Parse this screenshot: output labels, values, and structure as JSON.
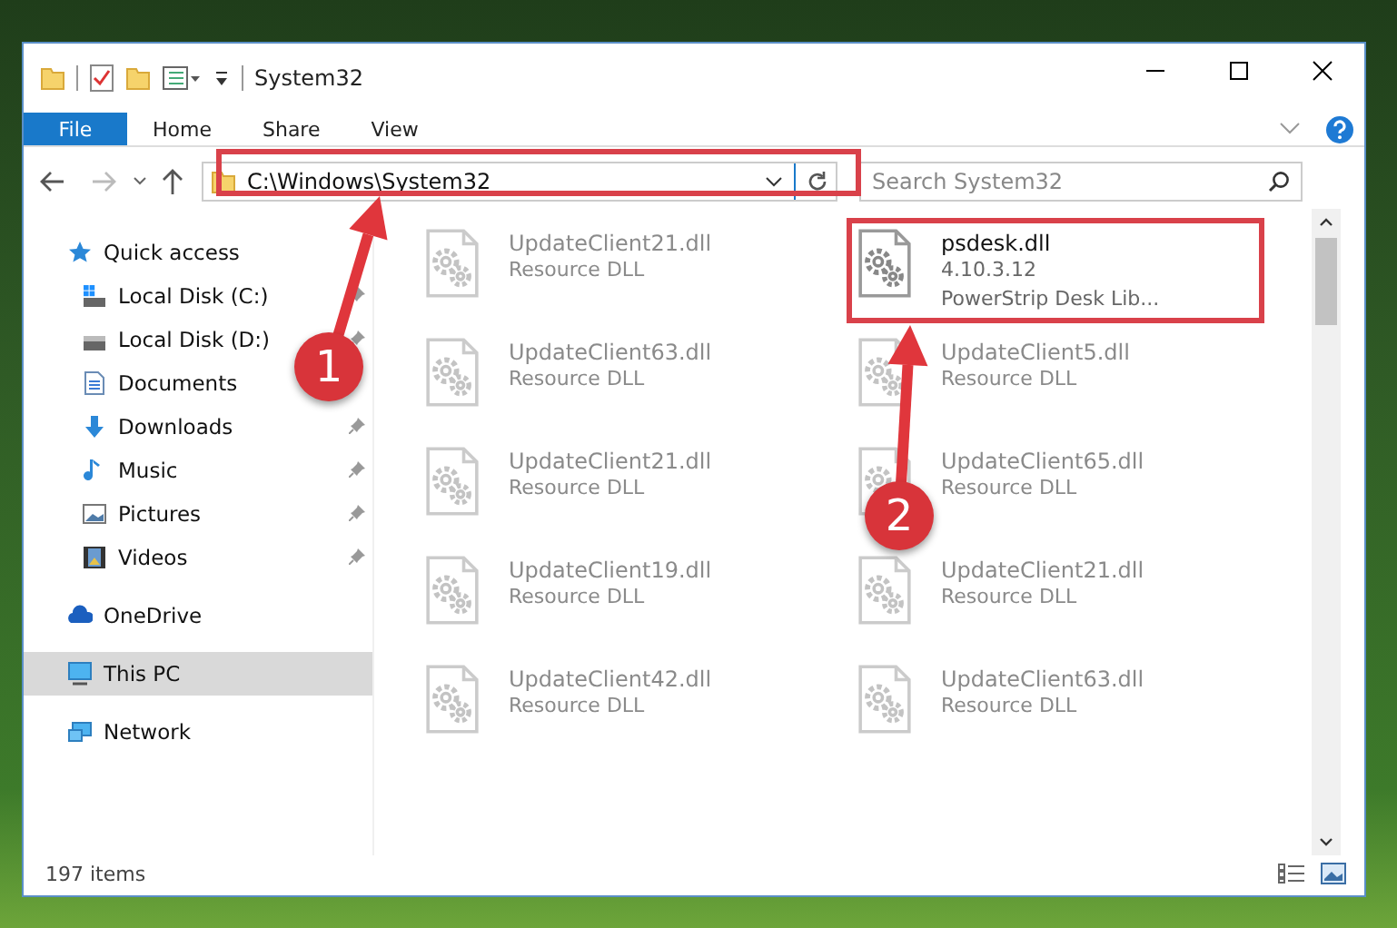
{
  "window": {
    "title": "System32"
  },
  "ribbon_tabs": [
    {
      "label": "File",
      "kind": "file"
    },
    {
      "label": "Home",
      "kind": "tab"
    },
    {
      "label": "Share",
      "kind": "tab"
    },
    {
      "label": "View",
      "kind": "tab"
    }
  ],
  "address_bar": {
    "value": "C:\\Windows\\System32"
  },
  "search": {
    "placeholder": "Search System32"
  },
  "sidebar": {
    "items": [
      {
        "label": "Quick access",
        "kind": "star",
        "selected": false,
        "children": [
          {
            "label": "Local Disk (C:)",
            "kind": "system-drive",
            "pinned": true,
            "selected": false
          },
          {
            "label": "Local Disk (D:)",
            "kind": "drive",
            "pinned": true,
            "selected": false
          },
          {
            "label": "Documents",
            "kind": "documents",
            "pinned": false,
            "selected": false
          },
          {
            "label": "Downloads",
            "kind": "downloads",
            "pinned": true,
            "selected": false
          },
          {
            "label": "Music",
            "kind": "music",
            "pinned": true,
            "selected": false
          },
          {
            "label": "Pictures",
            "kind": "pictures",
            "pinned": true,
            "selected": false
          },
          {
            "label": "Videos",
            "kind": "videos",
            "pinned": true,
            "selected": false
          }
        ]
      },
      {
        "label": "OneDrive",
        "kind": "cloud",
        "selected": false
      },
      {
        "label": "This PC",
        "kind": "computer",
        "selected": true
      },
      {
        "label": "Network",
        "kind": "network",
        "selected": false
      }
    ]
  },
  "files": [
    {
      "name": "UpdateClient21.dll",
      "line_1": "Resource DLL",
      "faded": true
    },
    {
      "name": "psdesk.dll",
      "line_1": "4.10.3.12",
      "line_2": "PowerStrip Desk Lib...",
      "faded": false
    },
    {
      "name": "UpdateClient63.dll",
      "line_1": "Resource DLL",
      "faded": true
    },
    {
      "name": "UpdateClient5.dll",
      "line_1": "Resource DLL",
      "faded": true
    },
    {
      "name": "UpdateClient21.dll",
      "line_1": "Resource DLL",
      "faded": true
    },
    {
      "name": "UpdateClient65.dll",
      "line_1": "Resource DLL",
      "faded": true
    },
    {
      "name": "UpdateClient19.dll",
      "line_1": "Resource DLL",
      "faded": true
    },
    {
      "name": "UpdateClient21.dll",
      "line_1": "Resource DLL",
      "faded": true
    },
    {
      "name": "UpdateClient42.dll",
      "line_1": "Resource DLL",
      "faded": true
    },
    {
      "name": "UpdateClient63.dll",
      "line_1": "Resource DLL",
      "faded": true
    }
  ],
  "status_bar": {
    "count": "197 items"
  },
  "annotations": [
    {
      "label": "1"
    },
    {
      "label": "2"
    }
  ]
}
